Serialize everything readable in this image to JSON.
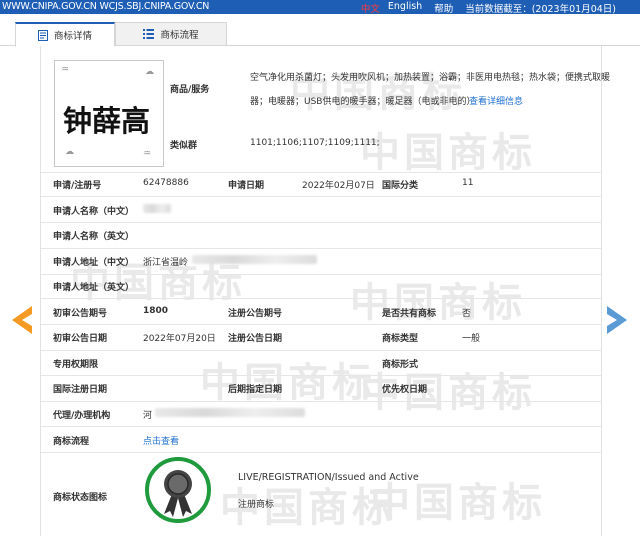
{
  "topbar": {
    "url": "WWW.CNIPA.GOV.CN WCJS.SBJ.CNIPA.GOV.CN",
    "lang_zh": "中文",
    "lang_en": "English",
    "help": "帮助",
    "data_date": "当前数据截至：(2023年01月04日)"
  },
  "tabs": [
    {
      "label": "商标详情",
      "icon": "document-icon",
      "active": true
    },
    {
      "label": "商标流程",
      "icon": "list-icon",
      "active": false
    }
  ],
  "logo": {
    "text": "钟薛高"
  },
  "goods": {
    "label": "商品/服务",
    "line1": "空气净化用杀菌灯；头发用吹风机；加热装置；浴霸；非医用电热毯；热水袋；便携式取暖",
    "line2": "器；电暖器；USB供电的暖手器；暖足器（电或非电的）",
    "detail_link": "查看详细信息"
  },
  "similar_group": {
    "label": "类似群",
    "value": "1101;1106;1107;1109;1111;"
  },
  "rows": {
    "reg_no_label": "申请/注册号",
    "reg_no": "62478886",
    "apply_date_label": "申请日期",
    "apply_date": "2022年02月07日",
    "intl_class_label": "国际分类",
    "intl_class": "11",
    "applicant_cn_label": "申请人名称（中文）",
    "applicant_en_label": "申请人名称（英文）",
    "address_cn_label": "申请人地址（中文）",
    "address_cn": "浙江省温岭",
    "address_en_label": "申请人地址（英文）",
    "prelim_no_label": "初审公告期号",
    "prelim_no": "1800",
    "reg_pub_no_label": "注册公告期号",
    "shared_label": "是否共有商标",
    "shared": "否",
    "prelim_date_label": "初审公告日期",
    "prelim_date": "2022年07月20日",
    "reg_pub_date_label": "注册公告日期",
    "type_label": "商标类型",
    "type": "一般",
    "exclusive_label": "专用权期限",
    "form_label": "商标形式",
    "intl_reg_date_label": "国际注册日期",
    "later_date_label": "后期指定日期",
    "priority_date_label": "优先权日期",
    "agent_label": "代理/办理机构",
    "agent": "河",
    "process_label": "商标流程",
    "process_link": "点击查看",
    "status_icon_label": "商标状态图标",
    "status_en": "LIVE/REGISTRATION/Issued and Active",
    "status_cn": "注册商标"
  },
  "watermark": {
    "text": "中国商标"
  },
  "colors": {
    "topbar": "#1e5eb5",
    "link": "#1e6fd0",
    "badge_green": "#1f9a3c",
    "arrow_left": "#f59a23",
    "arrow_right": "#5b9bd5"
  }
}
